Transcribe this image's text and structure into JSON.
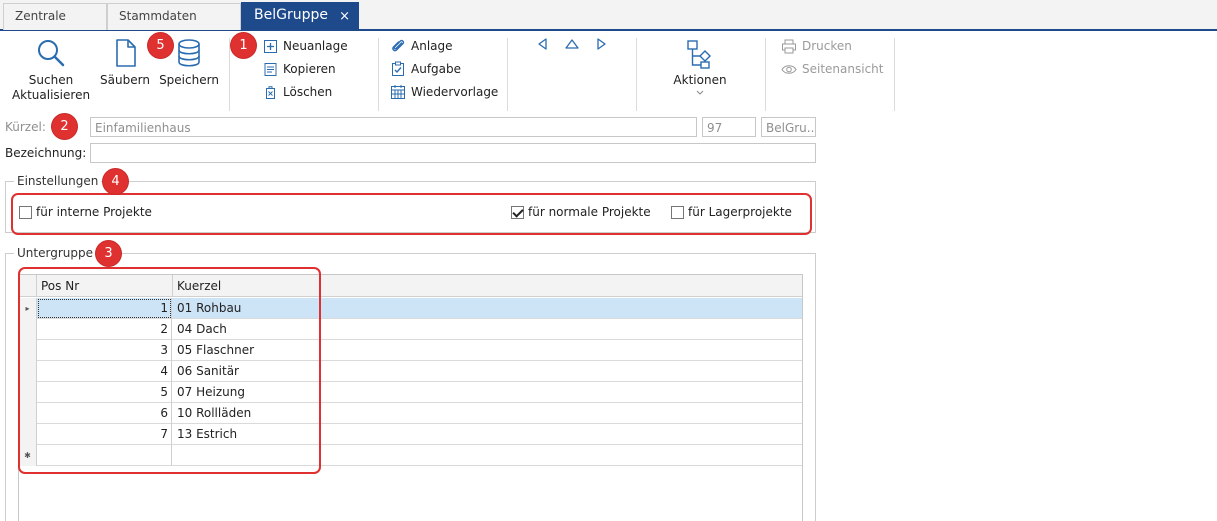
{
  "tabs": [
    {
      "label": "Zentrale"
    },
    {
      "label": "Stammdaten"
    },
    {
      "label": "BelGruppe",
      "close": "×"
    }
  ],
  "toolbar": {
    "search_refresh": "Suchen Aktualisieren",
    "search_line1": "Suchen",
    "search_line2": "Aktualisieren",
    "clear": "Säubern",
    "save": "Speichern",
    "new": "Neuanlage",
    "copy": "Kopieren",
    "delete": "Löschen",
    "attachment": "Anlage",
    "task": "Aufgabe",
    "resubmission": "Wiedervorlage",
    "actions": "Aktionen",
    "print": "Drucken",
    "page_view": "Seitenansicht"
  },
  "badges": {
    "b1": "1",
    "b2": "2",
    "b3": "3",
    "b4": "4",
    "b5": "5"
  },
  "form": {
    "kuerzel_label": "Kürzel:",
    "kuerzel_value": "Einfamilienhaus",
    "number_value": "97",
    "short_value": "BelGru...",
    "bezeichnung_label": "Bezeichnung:",
    "bezeichnung_value": ""
  },
  "settings": {
    "title": "Einstellungen",
    "internal": {
      "label": "für interne Projekte",
      "checked": false
    },
    "normal": {
      "label": "für normale Projekte",
      "checked": true
    },
    "storage": {
      "label": "für Lagerprojekte",
      "checked": false
    }
  },
  "subgroup": {
    "title": "Untergruppe",
    "columns": [
      "Pos Nr",
      "Kuerzel"
    ],
    "rows": [
      {
        "pos": "1",
        "kuerzel": "01 Rohbau"
      },
      {
        "pos": "2",
        "kuerzel": "04 Dach"
      },
      {
        "pos": "3",
        "kuerzel": "05 Flaschner"
      },
      {
        "pos": "4",
        "kuerzel": "06 Sanitär"
      },
      {
        "pos": "5",
        "kuerzel": "07 Heizung"
      },
      {
        "pos": "6",
        "kuerzel": "10 Rollläden"
      },
      {
        "pos": "7",
        "kuerzel": "13 Estrich"
      }
    ],
    "current_row_marker": "▸",
    "new_row_marker": "✱"
  },
  "colors": {
    "accent": "#1e4a8c",
    "badge": "#e03131",
    "icon": "#2b6cb0",
    "selected_row": "#cde3f6"
  }
}
